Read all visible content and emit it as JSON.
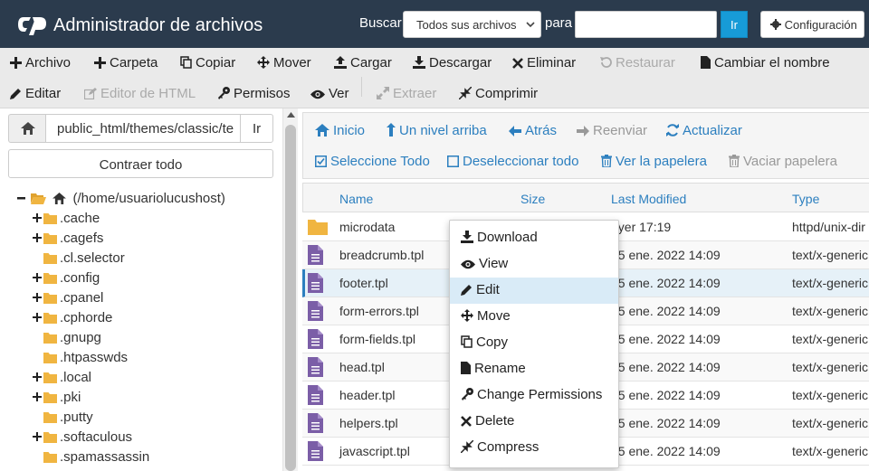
{
  "header": {
    "title": "Administrador de archivos",
    "search_label": "Buscar",
    "search_scope": "Todos sus archivos",
    "para_label": "para",
    "search_value": "",
    "go_label": "Ir",
    "config_label": "Configuración"
  },
  "toolbar": {
    "file": "Archivo",
    "folder": "Carpeta",
    "copy": "Copiar",
    "move": "Mover",
    "upload": "Cargar",
    "download": "Descargar",
    "delete": "Eliminar",
    "restore": "Restaurar",
    "rename": "Cambiar el nombre",
    "edit": "Editar",
    "html_editor": "Editor de HTML",
    "permissions": "Permisos",
    "view": "Ver",
    "extract": "Extraer",
    "compress": "Comprimir"
  },
  "sidebar": {
    "path": "public_html/themes/classic/te",
    "go_label": "Ir",
    "collapse_label": "Contraer todo",
    "root_label": "(/home/usuariolucushost)",
    "items": [
      {
        "name": ".cache",
        "expandable": true
      },
      {
        "name": ".cagefs",
        "expandable": true
      },
      {
        "name": ".cl.selector",
        "expandable": false
      },
      {
        "name": ".config",
        "expandable": true
      },
      {
        "name": ".cpanel",
        "expandable": true
      },
      {
        "name": ".cphorde",
        "expandable": true
      },
      {
        "name": ".gnupg",
        "expandable": false
      },
      {
        "name": ".htpasswds",
        "expandable": false
      },
      {
        "name": ".local",
        "expandable": true
      },
      {
        "name": ".pki",
        "expandable": true
      },
      {
        "name": ".putty",
        "expandable": false
      },
      {
        "name": ".softaculous",
        "expandable": true
      },
      {
        "name": ".spamassassin",
        "expandable": false
      }
    ]
  },
  "nav": {
    "home": "Inicio",
    "up": "Un nivel arriba",
    "back": "Atrás",
    "forward": "Reenviar",
    "refresh": "Actualizar",
    "select_all": "Seleccione Todo",
    "deselect_all": "Deseleccionar todo",
    "view_trash": "Ver la papelera",
    "empty_trash": "Vaciar papelera"
  },
  "table": {
    "columns": [
      "Name",
      "Size",
      "Last Modified",
      "Type"
    ],
    "rows": [
      {
        "name": "microdata",
        "modified": "ayer 17:19",
        "type": "httpd/unix-dir",
        "kind": "folder"
      },
      {
        "name": "breadcrumb.tpl",
        "modified": "15 ene. 2022 14:09",
        "type": "text/x-generic",
        "kind": "file"
      },
      {
        "name": "footer.tpl",
        "modified": "15 ene. 2022 14:09",
        "type": "text/x-generic",
        "kind": "file"
      },
      {
        "name": "form-errors.tpl",
        "modified": "15 ene. 2022 14:09",
        "type": "text/x-generic",
        "kind": "file"
      },
      {
        "name": "form-fields.tpl",
        "modified": "15 ene. 2022 14:09",
        "type": "text/x-generic",
        "kind": "file"
      },
      {
        "name": "head.tpl",
        "modified": "15 ene. 2022 14:09",
        "type": "text/x-generic",
        "kind": "file"
      },
      {
        "name": "header.tpl",
        "modified": "15 ene. 2022 14:09",
        "type": "text/x-generic",
        "kind": "file"
      },
      {
        "name": "helpers.tpl",
        "modified": "15 ene. 2022 14:09",
        "type": "text/x-generic",
        "kind": "file"
      },
      {
        "name": "javascript.tpl",
        "modified": "15 ene. 2022 14:09",
        "type": "text/x-generic",
        "kind": "file"
      }
    ]
  },
  "context_menu": {
    "items": [
      "Download",
      "View",
      "Edit",
      "Move",
      "Copy",
      "Rename",
      "Change Permissions",
      "Delete",
      "Compress"
    ]
  },
  "colors": {
    "header_bg": "#2b3b4d",
    "accent": "#2c7fbf",
    "folder": "#f0b541",
    "file": "#7b5ea7"
  }
}
